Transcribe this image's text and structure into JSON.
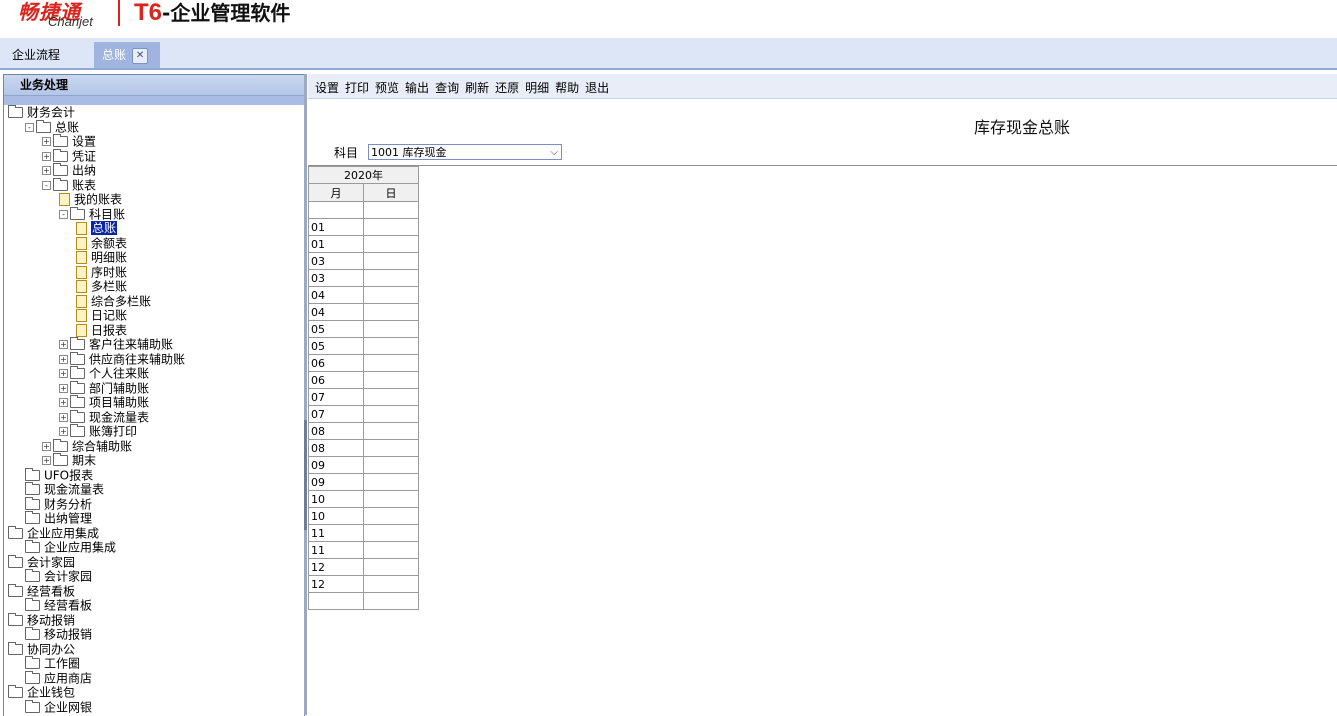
{
  "header": {
    "logo_cn": "畅捷通",
    "logo_en": "Chanjet",
    "product_prefix": "T6",
    "product_suffix": "-企业管理软件"
  },
  "tabs": [
    {
      "label": "企业流程",
      "active": false
    },
    {
      "label": "总账",
      "active": true,
      "close": "✕"
    }
  ],
  "left_panel": {
    "title": "业务处理",
    "tree": [
      {
        "label": "财务会计",
        "depth": 0,
        "type": "folder",
        "exp": ""
      },
      {
        "label": "总账",
        "depth": 1,
        "type": "folder",
        "exp": "-"
      },
      {
        "label": "设置",
        "depth": 2,
        "type": "folder",
        "exp": "+"
      },
      {
        "label": "凭证",
        "depth": 2,
        "type": "folder",
        "exp": "+"
      },
      {
        "label": "出纳",
        "depth": 2,
        "type": "folder",
        "exp": "+"
      },
      {
        "label": "账表",
        "depth": 2,
        "type": "folder",
        "exp": "-"
      },
      {
        "label": "我的账表",
        "depth": 3,
        "type": "doc",
        "exp": ""
      },
      {
        "label": "科目账",
        "depth": 3,
        "type": "folder",
        "exp": "-"
      },
      {
        "label": "总账",
        "depth": 4,
        "type": "doc",
        "exp": "",
        "selected": true
      },
      {
        "label": "余额表",
        "depth": 4,
        "type": "doc",
        "exp": ""
      },
      {
        "label": "明细账",
        "depth": 4,
        "type": "doc",
        "exp": ""
      },
      {
        "label": "序时账",
        "depth": 4,
        "type": "doc",
        "exp": ""
      },
      {
        "label": "多栏账",
        "depth": 4,
        "type": "doc",
        "exp": ""
      },
      {
        "label": "综合多栏账",
        "depth": 4,
        "type": "doc",
        "exp": ""
      },
      {
        "label": "日记账",
        "depth": 4,
        "type": "doc",
        "exp": ""
      },
      {
        "label": "日报表",
        "depth": 4,
        "type": "doc",
        "exp": ""
      },
      {
        "label": "客户往来辅助账",
        "depth": 3,
        "type": "folder",
        "exp": "+"
      },
      {
        "label": "供应商往来辅助账",
        "depth": 3,
        "type": "folder",
        "exp": "+"
      },
      {
        "label": "个人往来账",
        "depth": 3,
        "type": "folder",
        "exp": "+"
      },
      {
        "label": "部门辅助账",
        "depth": 3,
        "type": "folder",
        "exp": "+"
      },
      {
        "label": "项目辅助账",
        "depth": 3,
        "type": "folder",
        "exp": "+"
      },
      {
        "label": "现金流量表",
        "depth": 3,
        "type": "folder",
        "exp": "+"
      },
      {
        "label": "账簿打印",
        "depth": 3,
        "type": "folder",
        "exp": "+"
      },
      {
        "label": "综合辅助账",
        "depth": 2,
        "type": "folder",
        "exp": "+"
      },
      {
        "label": "期末",
        "depth": 2,
        "type": "folder",
        "exp": "+"
      },
      {
        "label": "UFO报表",
        "depth": 1,
        "type": "folder",
        "exp": ""
      },
      {
        "label": "现金流量表",
        "depth": 1,
        "type": "folder",
        "exp": ""
      },
      {
        "label": "财务分析",
        "depth": 1,
        "type": "folder",
        "exp": ""
      },
      {
        "label": "出纳管理",
        "depth": 1,
        "type": "folder",
        "exp": ""
      },
      {
        "label": "企业应用集成",
        "depth": 0,
        "type": "folder",
        "exp": ""
      },
      {
        "label": "企业应用集成",
        "depth": 1,
        "type": "folder",
        "exp": ""
      },
      {
        "label": "会计家园",
        "depth": 0,
        "type": "folder",
        "exp": ""
      },
      {
        "label": "会计家园",
        "depth": 1,
        "type": "folder",
        "exp": ""
      },
      {
        "label": "经营看板",
        "depth": 0,
        "type": "folder",
        "exp": ""
      },
      {
        "label": "经营看板",
        "depth": 1,
        "type": "folder",
        "exp": ""
      },
      {
        "label": "移动报销",
        "depth": 0,
        "type": "folder",
        "exp": ""
      },
      {
        "label": "移动报销",
        "depth": 1,
        "type": "folder",
        "exp": ""
      },
      {
        "label": "协同办公",
        "depth": 0,
        "type": "folder",
        "exp": ""
      },
      {
        "label": "工作圈",
        "depth": 1,
        "type": "folder",
        "exp": ""
      },
      {
        "label": "应用商店",
        "depth": 1,
        "type": "folder",
        "exp": ""
      },
      {
        "label": "企业钱包",
        "depth": 0,
        "type": "folder",
        "exp": ""
      },
      {
        "label": "企业网银",
        "depth": 1,
        "type": "folder",
        "exp": ""
      }
    ]
  },
  "toolbar": [
    "设置",
    "打印",
    "预览",
    "输出",
    "查询",
    "刷新",
    "还原",
    "明细",
    "帮助",
    "退出"
  ],
  "report": {
    "title": "库存现金总账",
    "subject_label": "科目",
    "subject_value": "1001 库存现金",
    "year_header": "2020年",
    "month_header": "月",
    "day_header": "日",
    "rows": [
      {
        "month": "",
        "day": ""
      },
      {
        "month": "01",
        "day": ""
      },
      {
        "month": "01",
        "day": ""
      },
      {
        "month": "03",
        "day": ""
      },
      {
        "month": "03",
        "day": ""
      },
      {
        "month": "04",
        "day": ""
      },
      {
        "month": "04",
        "day": ""
      },
      {
        "month": "05",
        "day": ""
      },
      {
        "month": "05",
        "day": ""
      },
      {
        "month": "06",
        "day": ""
      },
      {
        "month": "06",
        "day": ""
      },
      {
        "month": "07",
        "day": ""
      },
      {
        "month": "07",
        "day": ""
      },
      {
        "month": "08",
        "day": ""
      },
      {
        "month": "08",
        "day": ""
      },
      {
        "month": "09",
        "day": ""
      },
      {
        "month": "09",
        "day": ""
      },
      {
        "month": "10",
        "day": ""
      },
      {
        "month": "10",
        "day": ""
      },
      {
        "month": "11",
        "day": ""
      },
      {
        "month": "11",
        "day": ""
      },
      {
        "month": "12",
        "day": ""
      },
      {
        "month": "12",
        "day": ""
      },
      {
        "month": "",
        "day": ""
      }
    ]
  }
}
